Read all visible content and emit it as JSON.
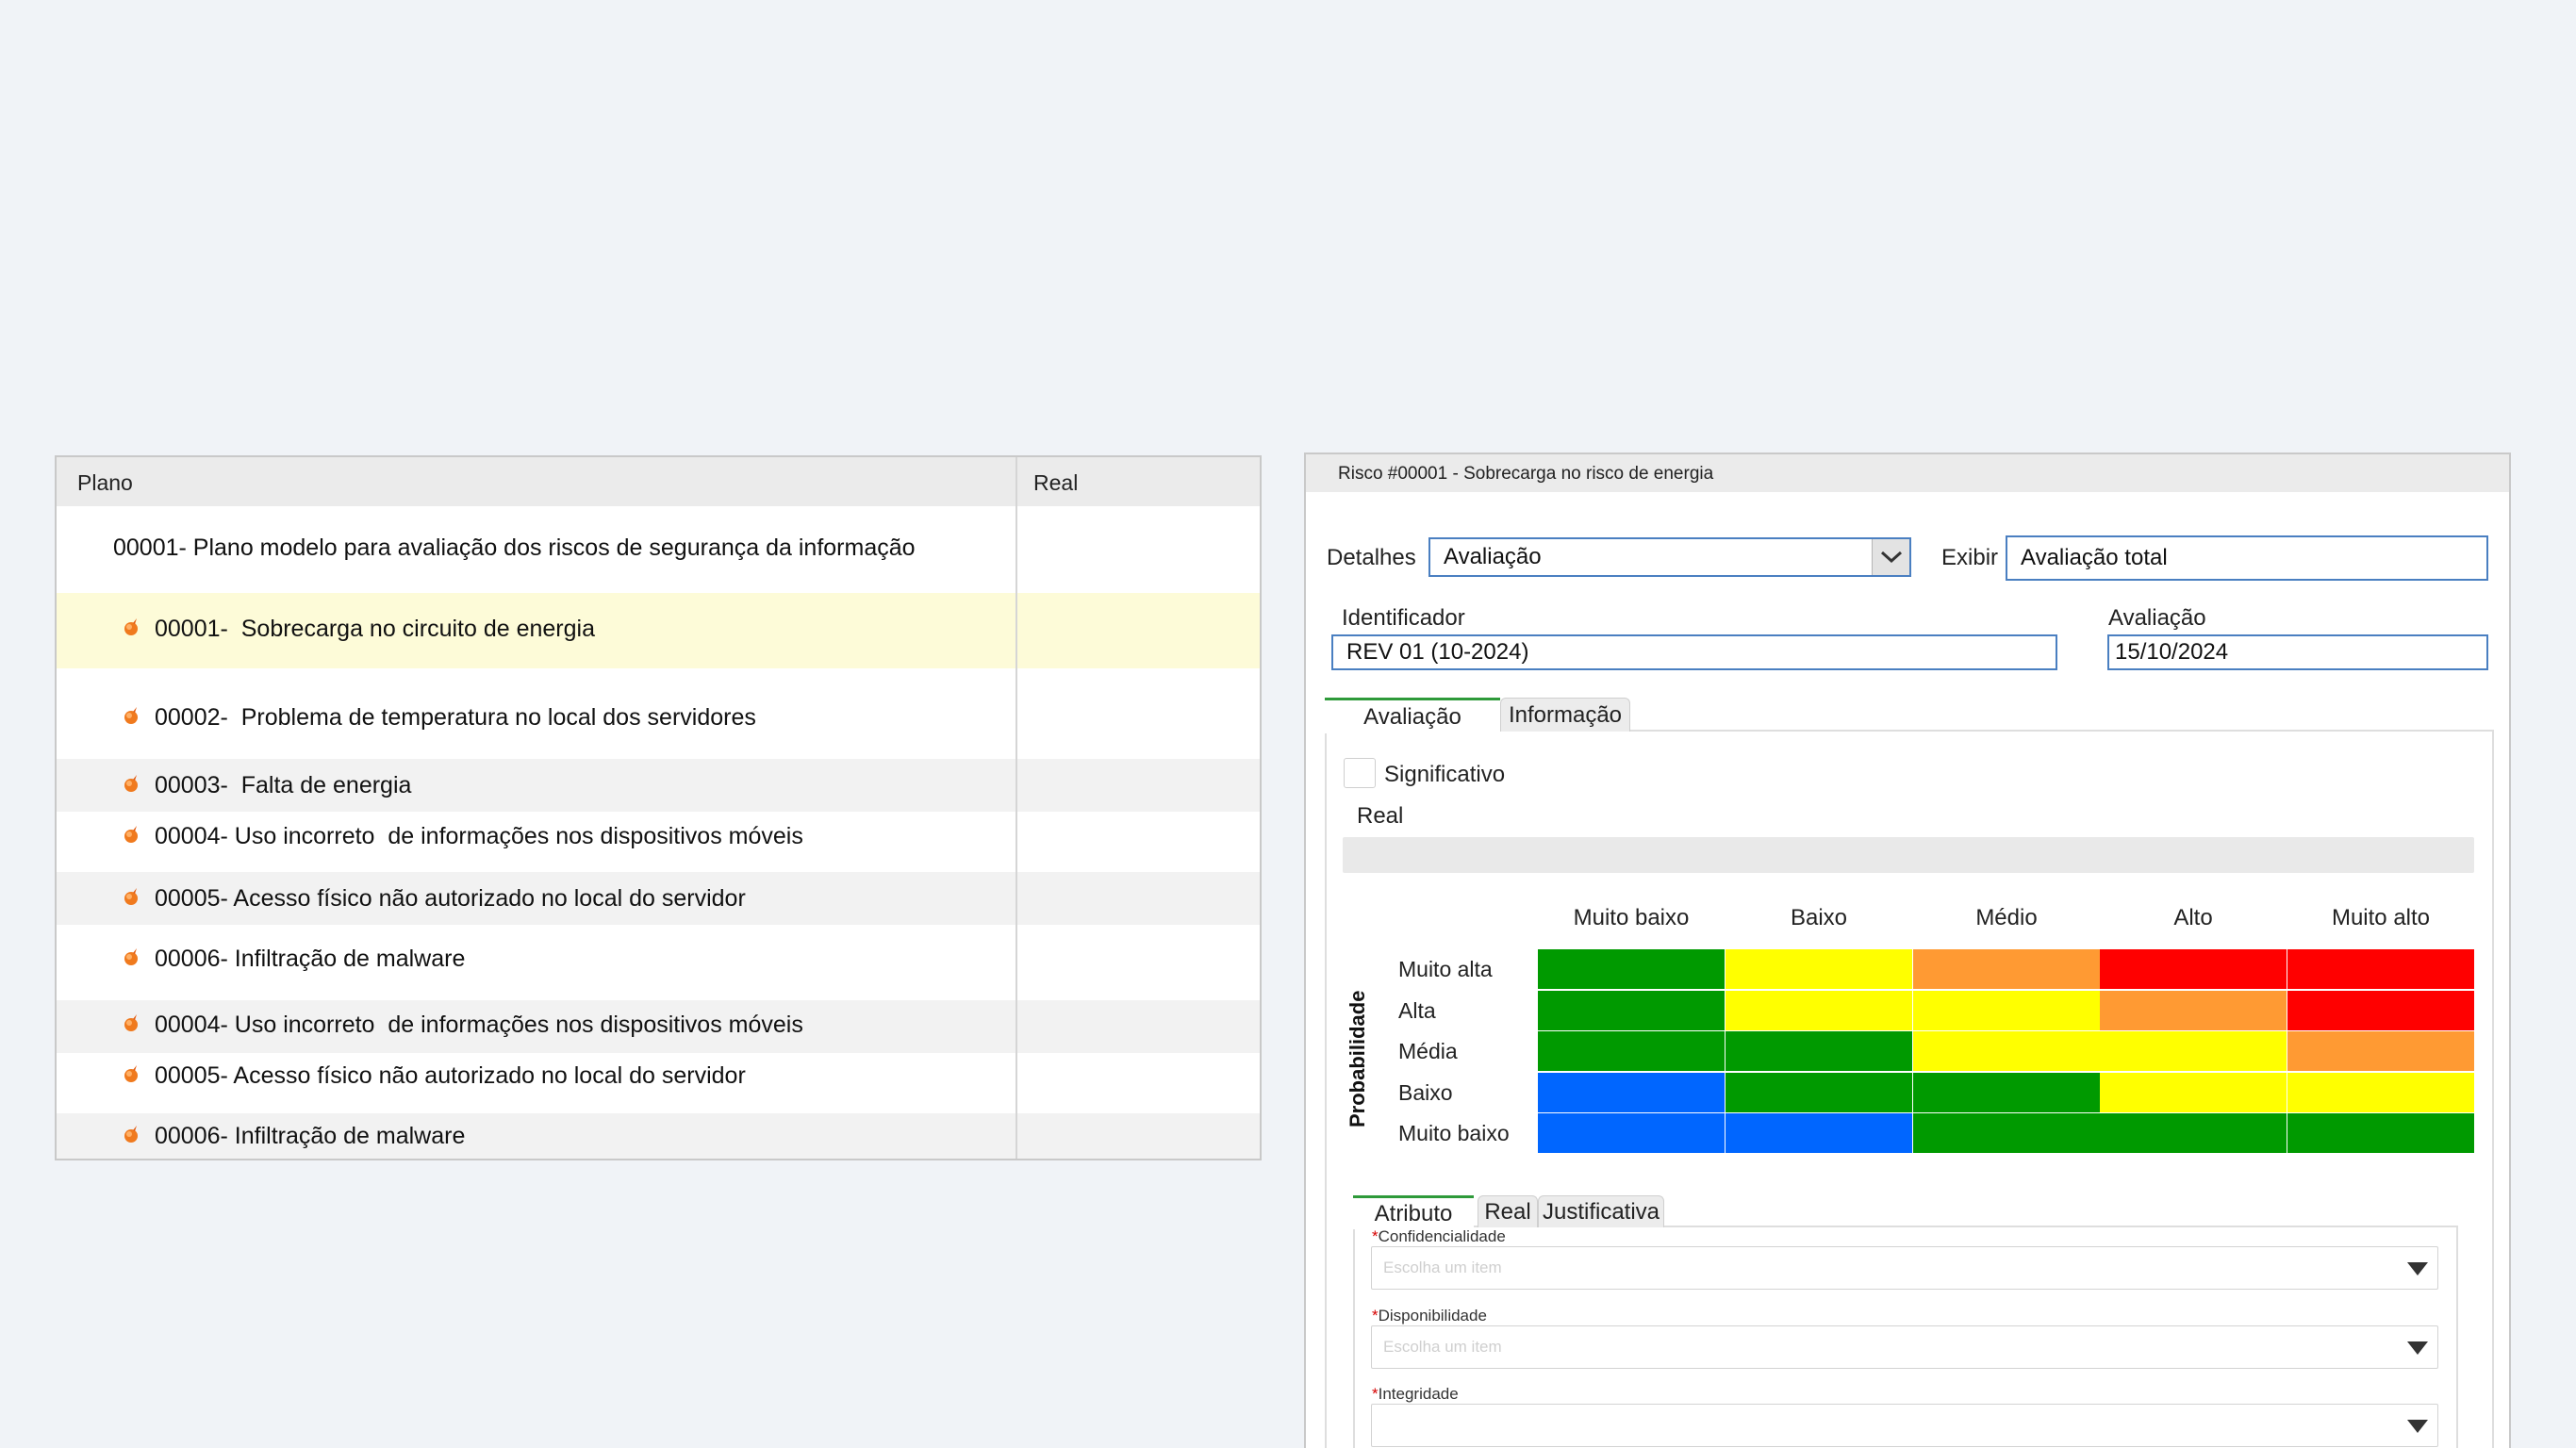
{
  "plan_table": {
    "headers": {
      "plano": "Plano",
      "real": "Real"
    },
    "rows": [
      {
        "text": "00001- Plano modelo para avaliação dos riscos de segurança da informação",
        "type": "plan",
        "highlight": false
      },
      {
        "text": "00001-  Sobrecarga no circuito de energia",
        "type": "risk",
        "highlight": true
      },
      {
        "text": "00002-  Problema de temperatura no local dos servidores",
        "type": "risk",
        "highlight": false
      },
      {
        "text": "00003-  Falta de energia",
        "type": "risk",
        "highlight": false
      },
      {
        "text": "00004- Uso incorreto  de informações nos dispositivos móveis",
        "type": "risk",
        "highlight": false
      },
      {
        "text": "00005- Acesso físico não autorizado no local do servidor",
        "type": "risk",
        "highlight": false
      },
      {
        "text": "00006- Infiltração de malware",
        "type": "risk",
        "highlight": false
      },
      {
        "text": "00004- Uso incorreto  de informações nos dispositivos móveis",
        "type": "risk",
        "highlight": false
      },
      {
        "text": "00005- Acesso físico não autorizado no local do servidor",
        "type": "risk",
        "highlight": false
      },
      {
        "text": "00006- Infiltração de malware",
        "type": "risk",
        "highlight": false
      }
    ]
  },
  "risk_panel": {
    "title": "Risco #00001 - Sobrecarga no risco de energia",
    "detalhes": {
      "label": "Detalhes",
      "value": "Avaliação"
    },
    "exibir": {
      "label": "Exibir",
      "value": "Avaliação total"
    },
    "identificador": {
      "label": "Identificador",
      "value": "REV 01 (10-2024)"
    },
    "avaliacao": {
      "label": "Avaliação",
      "value": "15/10/2024"
    },
    "tabs": [
      {
        "label": "Avaliação",
        "active": true
      },
      {
        "label": "Informação",
        "active": false
      }
    ],
    "significativo_label": "Significativo",
    "significativo_checked": false,
    "real_label": "Real",
    "matrix": {
      "axis_label": "Probabilidade",
      "columns": [
        "Muito baixo",
        "Baixo",
        "Médio",
        "Alto",
        "Muito alto"
      ],
      "rows": [
        "Muito alta",
        "Alta",
        "Média",
        "Baixo",
        "Muito baixo"
      ],
      "cells": [
        [
          "green",
          "yellow",
          "orange",
          "red",
          "red"
        ],
        [
          "green",
          "yellow",
          "yellow",
          "orange",
          "red"
        ],
        [
          "green",
          "green",
          "yellow",
          "yellow",
          "orange"
        ],
        [
          "blue",
          "green",
          "green",
          "yellow",
          "yellow"
        ],
        [
          "blue",
          "blue",
          "green",
          "green",
          "green"
        ]
      ],
      "colors": {
        "green": "#009a00",
        "yellow": "#ffff00",
        "orange": "#ff9a33",
        "red": "#ff0000",
        "blue": "#0066ff"
      }
    },
    "sub_tabs": [
      {
        "label": "Atributo",
        "active": true
      },
      {
        "label": "Real",
        "active": false
      },
      {
        "label": "Justificativa",
        "active": false
      }
    ],
    "fields": [
      {
        "label": "Confidencialidade",
        "placeholder": "Escolha um item"
      },
      {
        "label": "Disponibilidade",
        "placeholder": "Escolha um item"
      },
      {
        "label": "Integridade",
        "placeholder": ""
      }
    ]
  }
}
